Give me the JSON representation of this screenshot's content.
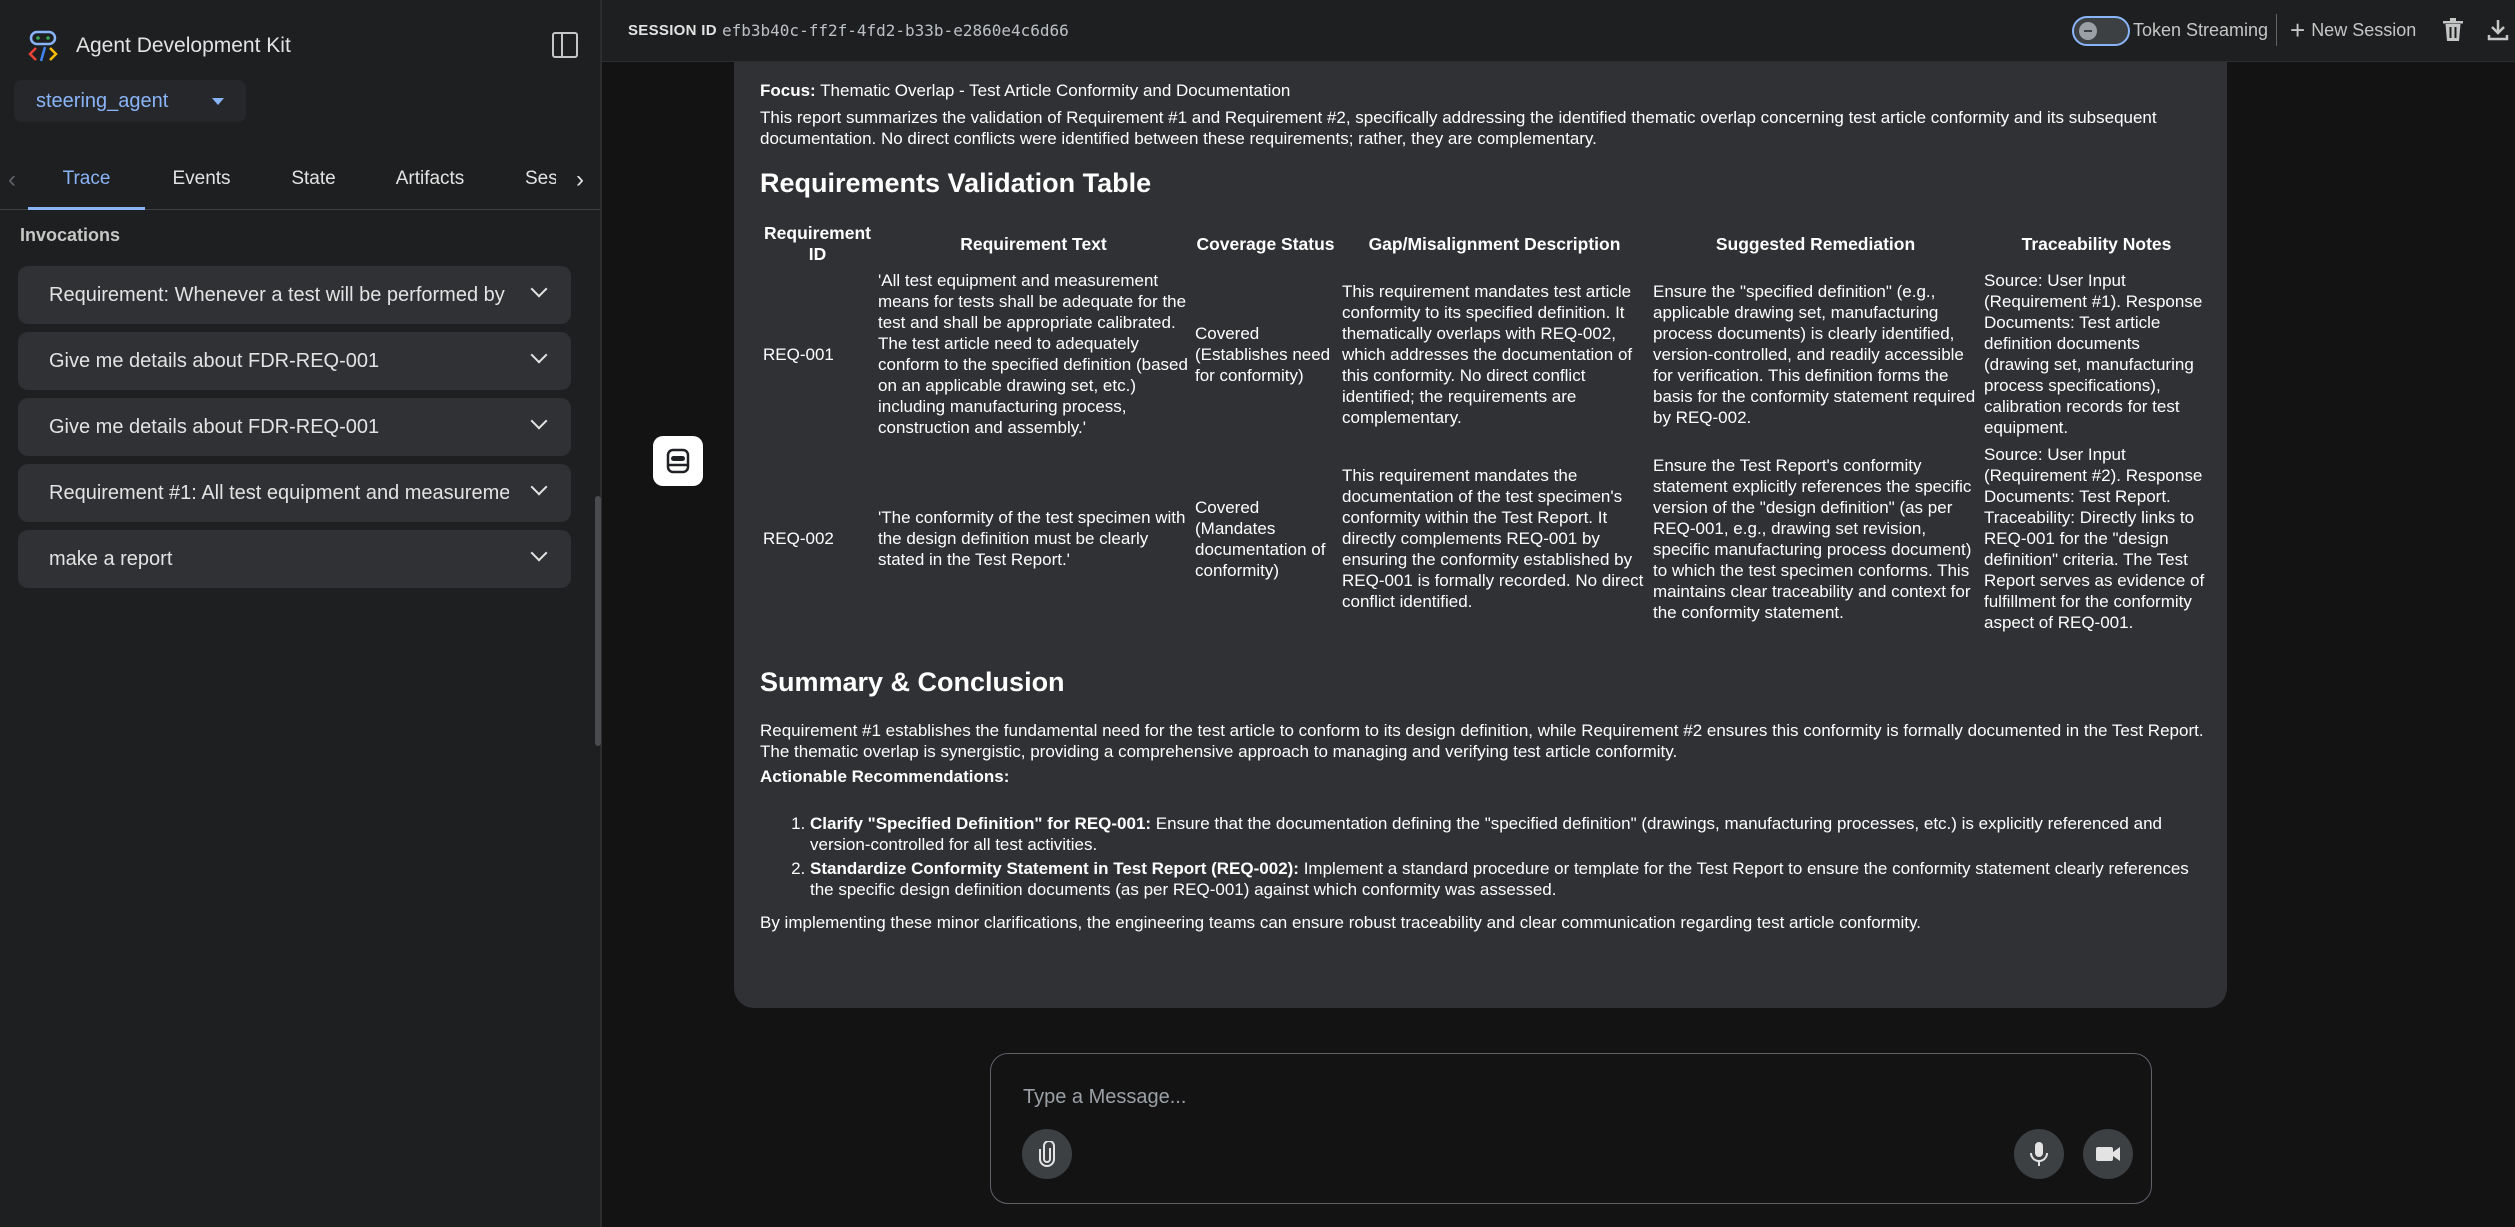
{
  "sidebar": {
    "brand_title": "Agent Development Kit",
    "agent_selected": "steering_agent",
    "tabs": [
      "Trace",
      "Events",
      "State",
      "Artifacts",
      "Sessions"
    ],
    "tab_visible_last": "Sess",
    "section_label": "Invocations",
    "invocations": [
      "Requirement: Whenever a test will be performed by",
      "Give me details about FDR-REQ-001",
      "Give me details about FDR-REQ-001",
      "Requirement #1: All test equipment and measureme",
      "make a report"
    ]
  },
  "header": {
    "session_label": "SESSION ID",
    "session_id": "efb3b40c-ff2f-4fd2-b33b-e2860e4c6d66",
    "token_streaming_label": "Token Streaming",
    "new_session_label": "New Session"
  },
  "message": {
    "focus_label": "Focus:",
    "focus_text": "Thematic Overlap - Test Article Conformity and Documentation",
    "intro": "This report summarizes the validation of Requirement #1 and Requirement #2, specifically addressing the identified thematic overlap concerning test article conformity and its subsequent documentation. No direct conflicts were identified between these requirements; rather, they are complementary.",
    "table_heading": "Requirements Validation Table",
    "table_headers": [
      "Requirement ID",
      "Requirement Text",
      "Coverage Status",
      "Gap/Misalignment Description",
      "Suggested Remediation",
      "Traceability Notes"
    ],
    "rows": [
      {
        "id": "REQ-001",
        "text": "'All test equipment and measurement means for tests shall be adequate for the test and shall be appropriate calibrated. The test article need to adequately conform to the specified definition (based on an applicable drawing set, etc.) including manufacturing process, construction and assembly.'",
        "coverage": "Covered (Establishes need for conformity)",
        "gap": "This requirement mandates test article conformity to its specified definition. It thematically overlaps with REQ-002, which addresses the documentation of this conformity. No direct conflict identified; the requirements are complementary.",
        "remediation": "Ensure the \"specified definition\" (e.g., applicable drawing set, manufacturing process documents) is clearly identified, version-controlled, and readily accessible for verification. This definition forms the basis for the conformity statement required by REQ-002.",
        "trace": "Source: User Input (Requirement #1). Response Documents: Test article definition documents (drawing set, manufacturing process specifications), calibration records for test equipment."
      },
      {
        "id": "REQ-002",
        "text": "'The conformity of the test specimen with the design definition must be clearly stated in the Test Report.'",
        "coverage": "Covered (Mandates documentation of conformity)",
        "gap": "This requirement mandates the documentation of the test specimen's conformity within the Test Report. It directly complements REQ-001 by ensuring the conformity established by REQ-001 is formally recorded. No direct conflict identified.",
        "remediation": "Ensure the Test Report's conformity statement explicitly references the specific version of the \"design definition\" (as per REQ-001, e.g., drawing set revision, specific manufacturing process document) to which the test specimen conforms. This maintains clear traceability and context for the conformity statement.",
        "trace": "Source: User Input (Requirement #2). Response Documents: Test Report. Traceability: Directly links to REQ-001 for the \"design definition\" criteria. The Test Report serves as evidence of fulfillment for the conformity aspect of REQ-001."
      }
    ],
    "summary_heading": "Summary & Conclusion",
    "summary_text": "Requirement #1 establishes the fundamental need for the test article to conform to its design definition, while Requirement #2 ensures this conformity is formally documented in the Test Report. The thematic overlap is synergistic, providing a comprehensive approach to managing and verifying test article conformity.",
    "recs_label": "Actionable Recommendations:",
    "recs": [
      {
        "title": "Clarify \"Specified Definition\" for REQ-001:",
        "text": "Ensure that the documentation defining the \"specified definition\" (drawings, manufacturing processes, etc.) is explicitly referenced and version-controlled for all test activities."
      },
      {
        "title": "Standardize Conformity Statement in Test Report (REQ-002):",
        "text": "Implement a standard procedure or template for the Test Report to ensure the conformity statement clearly references the specific design definition documents (as per REQ-001) against which conformity was assessed."
      }
    ],
    "closing": "By implementing these minor clarifications, the engineering teams can ensure robust traceability and clear communication regarding test article conformity."
  },
  "composer": {
    "placeholder": "Type a Message..."
  }
}
